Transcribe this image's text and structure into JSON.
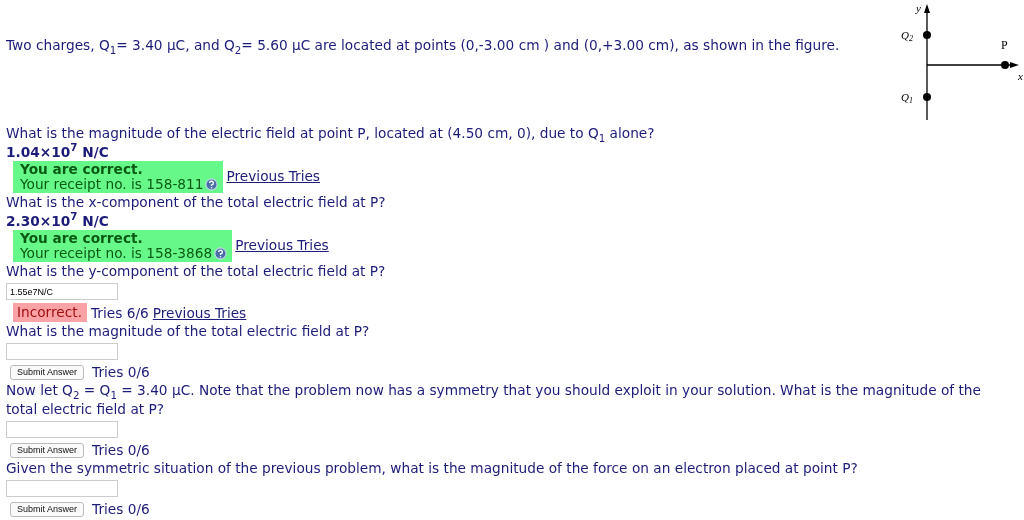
{
  "intro": "Two charges, Q$_{1}$= 3.40 μC, and Q$_{2}$= 5.60 μC are located at points (0,-3.00 cm ) and (0,+3.00 cm), as shown in the figure.",
  "figure": {
    "y_label": "y",
    "x_label": "x",
    "point_label": "P",
    "charge_labels": [
      "Q",
      "Q"
    ],
    "charge_subscripts": [
      "2",
      "1"
    ]
  },
  "questions": [
    {
      "kind": "answered",
      "prompt": "What is the magnitude of the electric field at point P, located at (4.50 cm, 0), due to Q$_{1}$ alone?",
      "answer": "1.04×10$^{7}$ N/C",
      "correct": true,
      "status_text": "You are correct.",
      "receipt": "Your receipt no. is 158-811",
      "link": "Previous Tries"
    },
    {
      "kind": "answered",
      "prompt": "What is the x-component of the total electric field at P?",
      "answer": "2.30×10$^{7}$ N/C",
      "correct": true,
      "status_text": "You are correct.",
      "receipt": "Your receipt no. is 158-3868",
      "link": "Previous Tries"
    },
    {
      "kind": "input",
      "prompt": "What is the y-component of the total electric field at P?",
      "value": "1.55e7N/C",
      "correct": false,
      "status_text": "Incorrect.",
      "tries": "Tries 6/6",
      "link": "Previous Tries"
    },
    {
      "kind": "input",
      "prompt": "What is the magnitude of the total electric field at P?",
      "button": "Submit Answer",
      "tries": "Tries 0/6"
    },
    {
      "kind": "input",
      "prompt": "Now let Q$_{2}$ = Q$_{1}$ = 3.40 μC. Note that the problem now has a symmetry that you should exploit in your solution. What is the magnitude of the total electric field at P?",
      "button": "Submit Answer",
      "tries": "Tries 0/6"
    },
    {
      "kind": "input",
      "prompt": "Given the symmetric situation of the previous problem, what is the magnitude of the force on an electron placed at point P?",
      "button": "Submit Answer",
      "tries": "Tries 0/6"
    }
  ]
}
